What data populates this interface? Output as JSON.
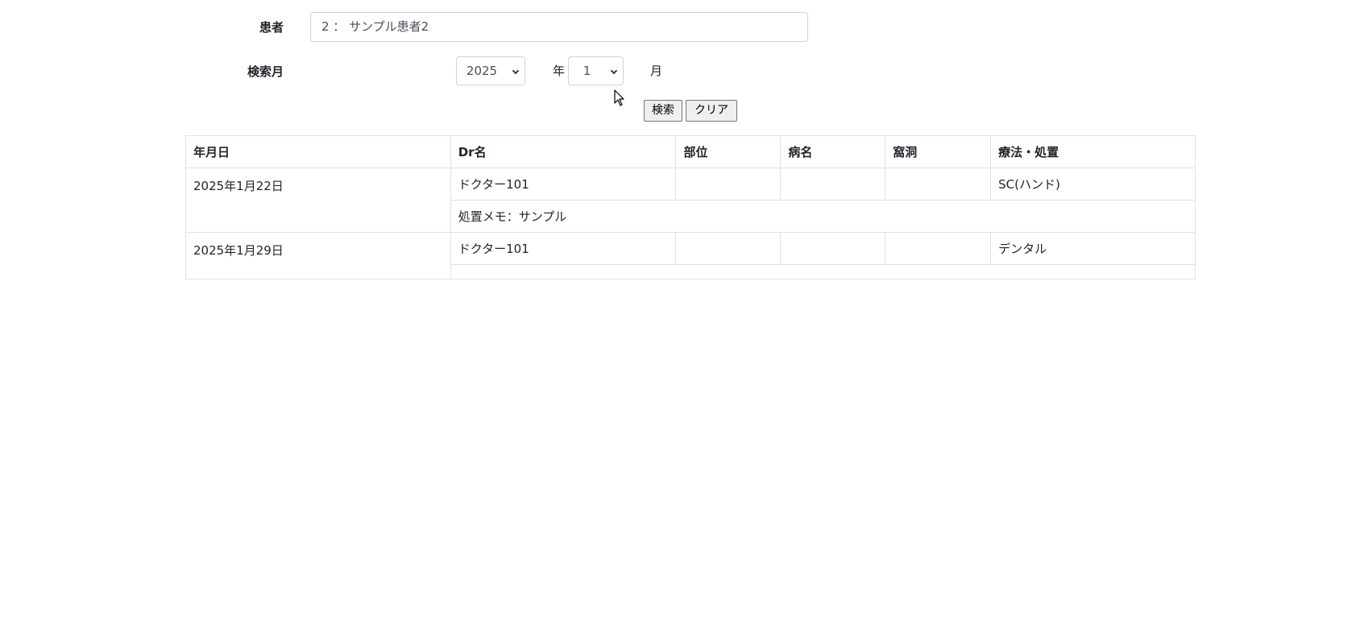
{
  "form": {
    "patient_label": "患者",
    "patient_value": "2 ： サンプル患者2",
    "search_month_label": "検索月",
    "year_value": "2025",
    "year_unit": "年",
    "month_value": "1",
    "month_unit": "月",
    "search_button": "検索",
    "clear_button": "クリア"
  },
  "table": {
    "headers": [
      "年月日",
      "Dr名",
      "部位",
      "病名",
      "窩洞",
      "療法・処置"
    ],
    "rows": [
      {
        "date": "2025年1月22日",
        "doctor": "ドクター101",
        "site": "",
        "disease": "",
        "cavity": "",
        "treatment": "SC(ハンド)",
        "memo": "処置メモ：サンプル"
      },
      {
        "date": "2025年1月29日",
        "doctor": "ドクター101",
        "site": "",
        "disease": "",
        "cavity": "",
        "treatment": "デンタル",
        "memo": ""
      }
    ]
  }
}
